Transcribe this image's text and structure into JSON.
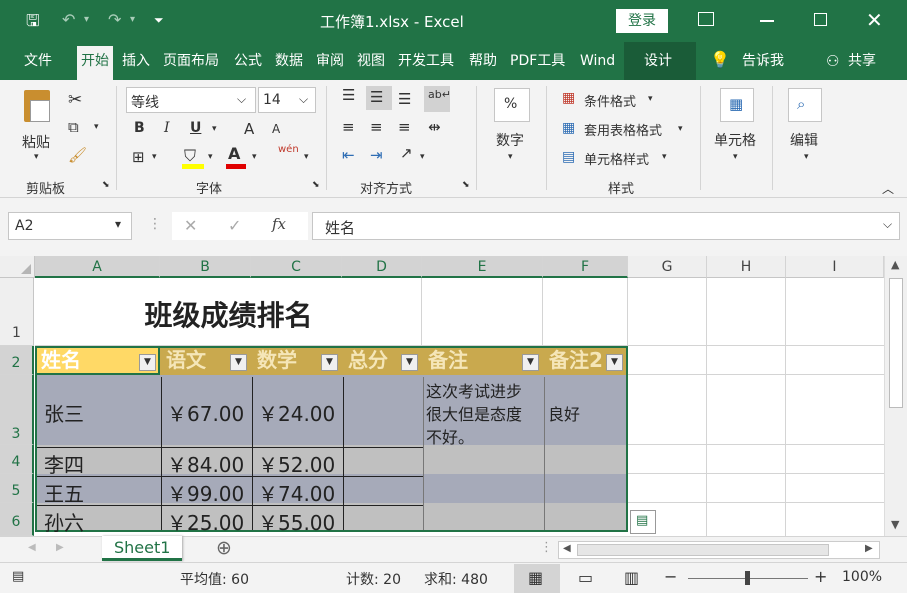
{
  "titlebar": {
    "title": "工作簿1.xlsx  -  Excel",
    "login": "登录"
  },
  "menu": [
    "文件",
    "开始",
    "插入",
    "页面布局",
    "公式",
    "数据",
    "审阅",
    "视图",
    "开发工具",
    "帮助",
    "PDF工具",
    "Wind",
    "设计"
  ],
  "tell_me": "告诉我",
  "share": "共享",
  "ribbon": {
    "paste": "粘贴",
    "clipboard": "剪贴板",
    "font_name": "等线",
    "font_size": "14",
    "font_group": "字体",
    "align_group": "对齐方式",
    "number": "数字",
    "cond_format": "条件格式",
    "table_format": "套用表格格式",
    "cell_style": "单元格样式",
    "style_group": "样式",
    "cells": "单元格",
    "edit": "编辑",
    "bold": "B",
    "italic": "I",
    "underline": "U",
    "grow": "A",
    "shrink": "A",
    "wen": "wén",
    "fx": "fx",
    "percent": "%"
  },
  "formula_bar": {
    "name_box": "A2",
    "content": "姓名"
  },
  "columns": [
    "A",
    "B",
    "C",
    "D",
    "E",
    "F",
    "G",
    "H",
    "I"
  ],
  "rows": [
    "1",
    "2",
    "3",
    "4",
    "5",
    "6"
  ],
  "sheet": {
    "title": "班级成绩排名",
    "headers": [
      "姓名",
      "语文",
      "数学",
      "总分",
      "备注",
      "备注2"
    ],
    "data": [
      {
        "name": "张三",
        "chinese": "￥67.00",
        "math": "￥24.00",
        "total": "",
        "note1": "这次考试进步",
        "note2": "很大但是态度",
        "note3": "不好。",
        "note_b": "良好"
      },
      {
        "name": "李四",
        "chinese": "￥84.00",
        "math": "￥52.00",
        "total": "",
        "note_b": ""
      },
      {
        "name": "王五",
        "chinese": "￥99.00",
        "math": "￥74.00",
        "total": "",
        "note_b": ""
      },
      {
        "name": "孙六",
        "chinese": "￥25.00",
        "math": "￥55.00",
        "total": "",
        "note_b": ""
      }
    ]
  },
  "tabs": {
    "sheet1": "Sheet1",
    "add": "⊕"
  },
  "status": {
    "average": "平均值: 60",
    "count": "计数: 20",
    "sum": "求和: 480",
    "zoom": "100%"
  },
  "colors": {
    "excel_green": "#217346",
    "header_gold": "#c9a94e",
    "header_yellow": "#ffd966",
    "row_blue": "#a6aab9",
    "row_gray": "#c0c0c0"
  }
}
